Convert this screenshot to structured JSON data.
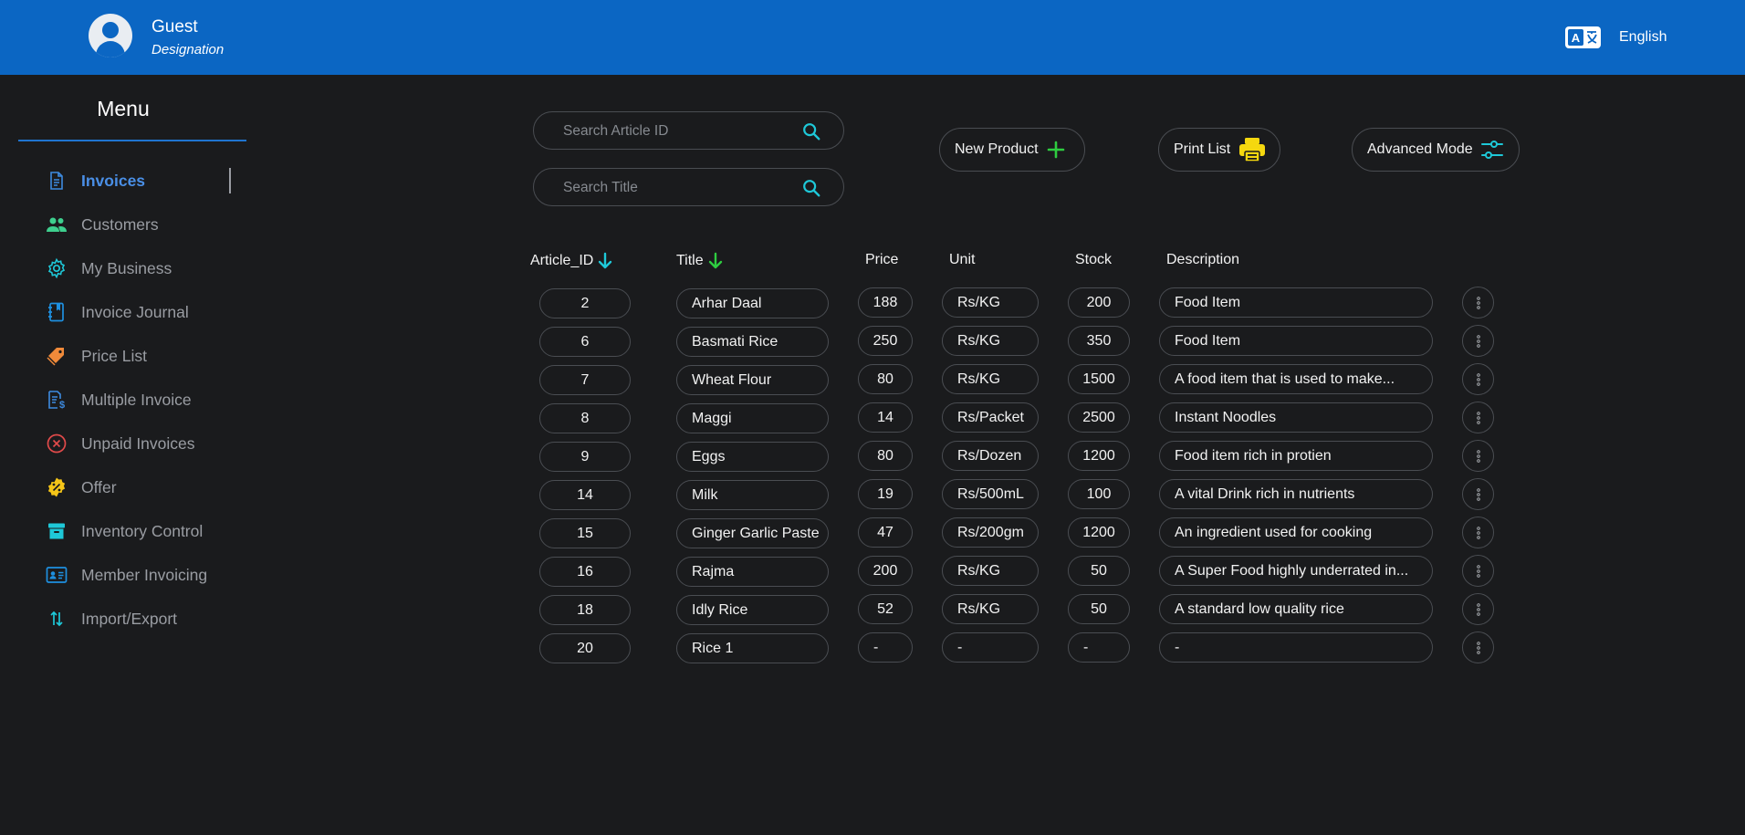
{
  "header": {
    "user_name": "Guest",
    "user_role": "Designation",
    "language": "English",
    "language_icon": "translate-icon",
    "avatar_icon": "user-avatar-icon"
  },
  "sidebar": {
    "title": "Menu",
    "items": [
      {
        "label": "Invoices",
        "icon": "document-icon",
        "active": true
      },
      {
        "label": "Customers",
        "icon": "users-icon"
      },
      {
        "label": "My Business",
        "icon": "gear-icon"
      },
      {
        "label": "Invoice Journal",
        "icon": "journal-icon"
      },
      {
        "label": "Price List",
        "icon": "price-tag-icon"
      },
      {
        "label": "Multiple Invoice",
        "icon": "invoice-dollar-icon"
      },
      {
        "label": "Unpaid Invoices",
        "icon": "cancel-circle-icon"
      },
      {
        "label": "Offer",
        "icon": "percent-badge-icon"
      },
      {
        "label": "Inventory Control",
        "icon": "archive-box-icon"
      },
      {
        "label": "Member Invoicing",
        "icon": "id-card-icon"
      },
      {
        "label": "Import/Export",
        "icon": "up-down-arrows-icon"
      }
    ]
  },
  "search": {
    "article_placeholder": "Search Article ID",
    "title_placeholder": "Search Title"
  },
  "actions": {
    "new_product": "New Product",
    "print_list": "Print List",
    "advanced_mode": "Advanced Mode"
  },
  "table": {
    "headers": {
      "article_id": "Article_ID",
      "title": "Title",
      "price": "Price",
      "unit": "Unit",
      "stock": "Stock",
      "description": "Description"
    },
    "rows": [
      {
        "id": "2",
        "title": "Arhar Daal",
        "price": "188",
        "unit": "Rs/KG",
        "stock": "200",
        "description": "Food Item"
      },
      {
        "id": "6",
        "title": "Basmati Rice",
        "price": "250",
        "unit": "Rs/KG",
        "stock": "350",
        "description": "Food Item"
      },
      {
        "id": "7",
        "title": "Wheat Flour",
        "price": "80",
        "unit": "Rs/KG",
        "stock": "1500",
        "description": "A food item that is used to make..."
      },
      {
        "id": "8",
        "title": "Maggi",
        "price": "14",
        "unit": "Rs/Packet",
        "stock": "2500",
        "description": "Instant Noodles"
      },
      {
        "id": "9",
        "title": "Eggs",
        "price": "80",
        "unit": "Rs/Dozen",
        "stock": "1200",
        "description": "Food item rich in protien"
      },
      {
        "id": "14",
        "title": "Milk",
        "price": "19",
        "unit": "Rs/500mL",
        "stock": "100",
        "description": "A vital Drink rich in nutrients"
      },
      {
        "id": "15",
        "title": "Ginger Garlic Paste",
        "price": "47",
        "unit": "Rs/200gm",
        "stock": "1200",
        "description": "An ingredient used for cooking"
      },
      {
        "id": "16",
        "title": "Rajma",
        "price": "200",
        "unit": "Rs/KG",
        "stock": "50",
        "description": "A Super Food highly underrated in..."
      },
      {
        "id": "18",
        "title": "Idly Rice",
        "price": "52",
        "unit": "Rs/KG",
        "stock": "50",
        "description": "A standard low quality rice"
      },
      {
        "id": "20",
        "title": "Rice 1",
        "price": "-",
        "unit": "-",
        "stock": "-",
        "description": "-"
      }
    ]
  },
  "colors": {
    "header_bg": "#0b66c3",
    "page_bg": "#1a1b1d",
    "active_nav": "#4a8fe6",
    "accent_cyan": "#1ec8d8",
    "accent_green": "#2ecc40",
    "accent_yellow": "#f5d80f"
  }
}
